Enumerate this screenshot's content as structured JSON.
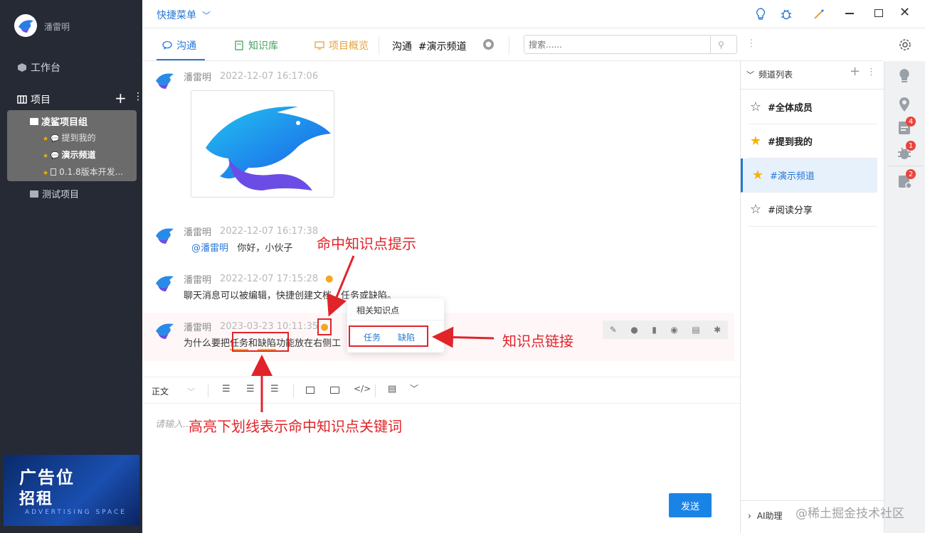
{
  "sidebar": {
    "user_name": "潘雷明",
    "workbench": "工作台",
    "projects": "项目",
    "group_name": "凌鲨项目组",
    "sub_items": [
      "提到我的",
      "演示频道",
      "0.1.8版本开发..."
    ],
    "test_project": "测试项目"
  },
  "ad": {
    "line1": "广告位",
    "line2": "招租",
    "line3": "ADVERTISING SPACE"
  },
  "topbar": {
    "quick_menu": "快捷菜单"
  },
  "tabs": [
    {
      "label": "沟通",
      "color": "#2878d6"
    },
    {
      "label": "知识库",
      "color": "#46a35e"
    },
    {
      "label": "项目概览",
      "color": "#e6a23c"
    }
  ],
  "channel_header": {
    "prefix": "沟通",
    "channel": "#演示频道"
  },
  "search": {
    "placeholder": "搜索......"
  },
  "messages": [
    {
      "name": "潘雷明",
      "time": "2022-12-07 16:17:06"
    },
    {
      "name": "潘雷明",
      "time": "2022-12-07 16:17:38",
      "mention": "@潘雷明",
      "text": "你好，小伙子"
    },
    {
      "name": "潘雷明",
      "time": "2022-12-07 17:15:28",
      "text": "聊天消息可以被编辑，快捷创建文档，任务或缺陷。"
    },
    {
      "name": "潘雷明",
      "time": "2023-03-23 10:11:35",
      "text_pre": "为什么要把",
      "kw1": "任务",
      "and": "和",
      "kw2": "缺陷",
      "text_post": "功能放在右侧工"
    }
  ],
  "popup": {
    "title": "相关知识点",
    "links": [
      "任务",
      "缺陷"
    ]
  },
  "editor": {
    "format": "正文",
    "placeholder": "请输入...",
    "send": "发送"
  },
  "channels": {
    "title": "频道列表",
    "items": [
      {
        "name": "#全体成员",
        "starred": false,
        "bold": true
      },
      {
        "name": "#提到我的",
        "starred": true,
        "bold": true
      },
      {
        "name": "#演示频道",
        "starred": true,
        "bold": false,
        "active": true
      },
      {
        "name": "#阅读分享",
        "starred": false,
        "bold": false
      }
    ],
    "ai_helper": "AI助理"
  },
  "rail_badges": {
    "doc": "4",
    "bug": "1",
    "task": "2"
  },
  "annotations": {
    "hit_tip": "命中知识点提示",
    "link": "知识点链接",
    "underline": "高亮下划线表示命中知识点关键词"
  },
  "watermark": "@稀土掘金技术社区",
  "colors": {
    "accent": "#2878d6",
    "annotation": "#e0242a",
    "star": "#f5b400"
  }
}
